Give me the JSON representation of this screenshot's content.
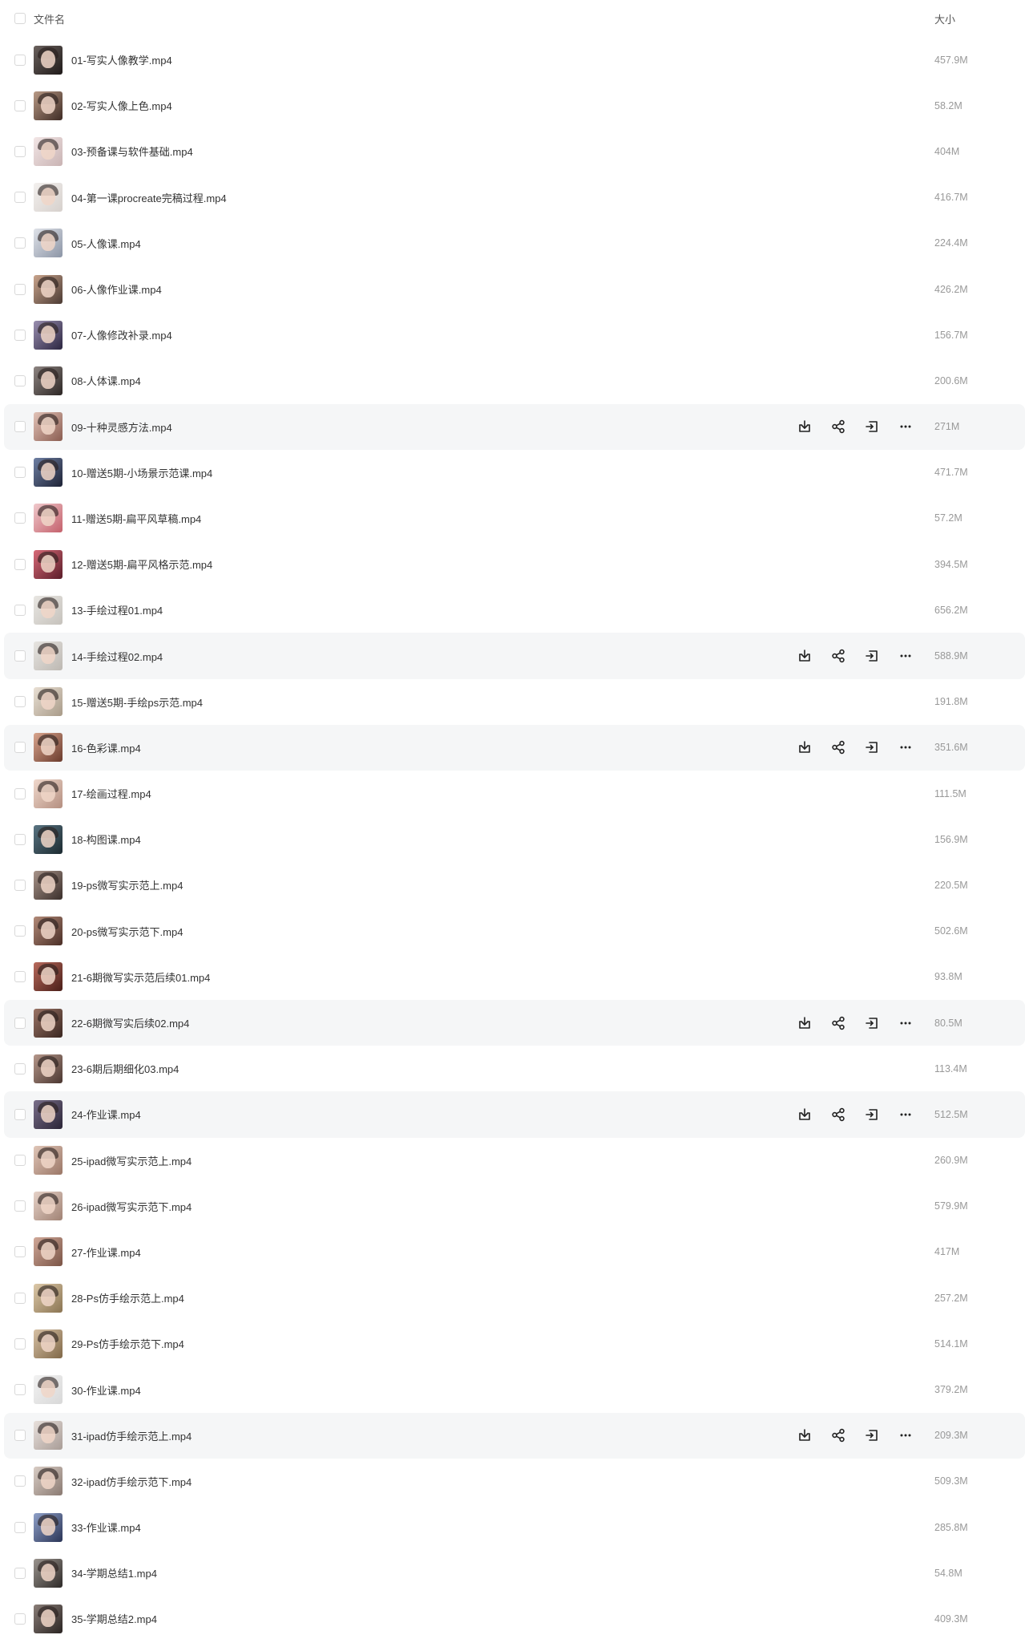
{
  "header": {
    "name_label": "文件名",
    "size_label": "大小"
  },
  "icons": {
    "download": "download-icon",
    "share": "share-icon",
    "move": "move-icon",
    "more": "more-icon"
  },
  "files": [
    {
      "name": "01-写实人像教学.mp4",
      "size": "457.9M",
      "thumb": [
        "#6b625e",
        "#1f1a19"
      ],
      "hover": false
    },
    {
      "name": "02-写实人像上色.mp4",
      "size": "58.2M",
      "thumb": [
        "#b99a86",
        "#3e2b24"
      ],
      "hover": false
    },
    {
      "name": "03-预备课与软件基础.mp4",
      "size": "404M",
      "thumb": [
        "#f2e6e6",
        "#c9b3b3"
      ],
      "hover": false
    },
    {
      "name": "04-第一课procreate完稿过程.mp4",
      "size": "416.7M",
      "thumb": [
        "#f3f0ee",
        "#d6d0cc"
      ],
      "hover": false
    },
    {
      "name": "05-人像课.mp4",
      "size": "224.4M",
      "thumb": [
        "#dfe2e8",
        "#8c95a6"
      ],
      "hover": false
    },
    {
      "name": "06-人像作业课.mp4",
      "size": "426.2M",
      "thumb": [
        "#c9a48c",
        "#4b3a33"
      ],
      "hover": false
    },
    {
      "name": "07-人像修改补录.mp4",
      "size": "156.7M",
      "thumb": [
        "#9a8fb0",
        "#2b2540"
      ],
      "hover": false
    },
    {
      "name": "08-人体课.mp4",
      "size": "200.6M",
      "thumb": [
        "#8e8582",
        "#2c2624"
      ],
      "hover": false
    },
    {
      "name": "09-十种灵感方法.mp4",
      "size": "271M",
      "thumb": [
        "#e2c3b8",
        "#8a5c50"
      ],
      "hover": true
    },
    {
      "name": "10-赠送5期-小场景示范课.mp4",
      "size": "471.7M",
      "thumb": [
        "#6e7fa3",
        "#1d2235"
      ],
      "hover": false
    },
    {
      "name": "11-赠送5期-扁平风草稿.mp4",
      "size": "57.2M",
      "thumb": [
        "#f0c9cc",
        "#c4606b"
      ],
      "hover": false
    },
    {
      "name": "12-赠送5期-扁平风格示范.mp4",
      "size": "394.5M",
      "thumb": [
        "#d86a78",
        "#5a1c28"
      ],
      "hover": false
    },
    {
      "name": "13-手绘过程01.mp4",
      "size": "656.2M",
      "thumb": [
        "#e8e6e2",
        "#c6c2bc"
      ],
      "hover": false
    },
    {
      "name": "14-手绘过程02.mp4",
      "size": "588.9M",
      "thumb": [
        "#e6e4e0",
        "#bdb8b2"
      ],
      "hover": true
    },
    {
      "name": "15-赠送5期-手绘ps示范.mp4",
      "size": "191.8M",
      "thumb": [
        "#e9e0d4",
        "#a89a88"
      ],
      "hover": false
    },
    {
      "name": "16-色彩课.mp4",
      "size": "351.6M",
      "thumb": [
        "#d9a58e",
        "#6a3a2c"
      ],
      "hover": true
    },
    {
      "name": "17-绘画过程.mp4",
      "size": "111.5M",
      "thumb": [
        "#f0d8cc",
        "#b48f80"
      ],
      "hover": false
    },
    {
      "name": "18-构图课.mp4",
      "size": "156.9M",
      "thumb": [
        "#5a7482",
        "#1b2a30"
      ],
      "hover": false
    },
    {
      "name": "19-ps微写实示范上.mp4",
      "size": "220.5M",
      "thumb": [
        "#a8948a",
        "#3a2e2a"
      ],
      "hover": false
    },
    {
      "name": "20-ps微写实示范下.mp4",
      "size": "502.6M",
      "thumb": [
        "#b28a78",
        "#4a2e26"
      ],
      "hover": false
    },
    {
      "name": "21-6期微写实示范后续01.mp4",
      "size": "93.8M",
      "thumb": [
        "#b86a5c",
        "#4a1e18"
      ],
      "hover": false
    },
    {
      "name": "22-6期微写实后续02.mp4",
      "size": "80.5M",
      "thumb": [
        "#9a7466",
        "#3a2620"
      ],
      "hover": true
    },
    {
      "name": "23-6期后期细化03.mp4",
      "size": "113.4M",
      "thumb": [
        "#b5978a",
        "#4a3630"
      ],
      "hover": false
    },
    {
      "name": "24-作业课.mp4",
      "size": "512.5M",
      "thumb": [
        "#7a6f8a",
        "#2a2436"
      ],
      "hover": true
    },
    {
      "name": "25-ipad微写实示范上.mp4",
      "size": "260.9M",
      "thumb": [
        "#e0c6b8",
        "#9a7666"
      ],
      "hover": false
    },
    {
      "name": "26-ipad微写实示范下.mp4",
      "size": "579.9M",
      "thumb": [
        "#e6d2c8",
        "#a08274"
      ],
      "hover": false
    },
    {
      "name": "27-作业课.mp4",
      "size": "417M",
      "thumb": [
        "#d0a898",
        "#7a5446"
      ],
      "hover": false
    },
    {
      "name": "28-Ps仿手绘示范上.mp4",
      "size": "257.2M",
      "thumb": [
        "#dcc8a8",
        "#8a7452"
      ],
      "hover": false
    },
    {
      "name": "29-Ps仿手绘示范下.mp4",
      "size": "514.1M",
      "thumb": [
        "#d6c0a4",
        "#806848"
      ],
      "hover": false
    },
    {
      "name": "30-作业课.mp4",
      "size": "379.2M",
      "thumb": [
        "#f2f2f2",
        "#d8d8d8"
      ],
      "hover": false
    },
    {
      "name": "31-ipad仿手绘示范上.mp4",
      "size": "209.3M",
      "thumb": [
        "#e8e0dc",
        "#a89c96"
      ],
      "hover": true
    },
    {
      "name": "32-ipad仿手绘示范下.mp4",
      "size": "509.3M",
      "thumb": [
        "#d8ccc4",
        "#8a7a72"
      ],
      "hover": false
    },
    {
      "name": "33-作业课.mp4",
      "size": "285.8M",
      "thumb": [
        "#8fa0c8",
        "#2a3456"
      ],
      "hover": false
    },
    {
      "name": "34-学期总结1.mp4",
      "size": "54.8M",
      "thumb": [
        "#9a948e",
        "#2e2a28"
      ],
      "hover": false
    },
    {
      "name": "35-学期总结2.mp4",
      "size": "409.3M",
      "thumb": [
        "#8a7e78",
        "#2a2422"
      ],
      "hover": false
    }
  ]
}
